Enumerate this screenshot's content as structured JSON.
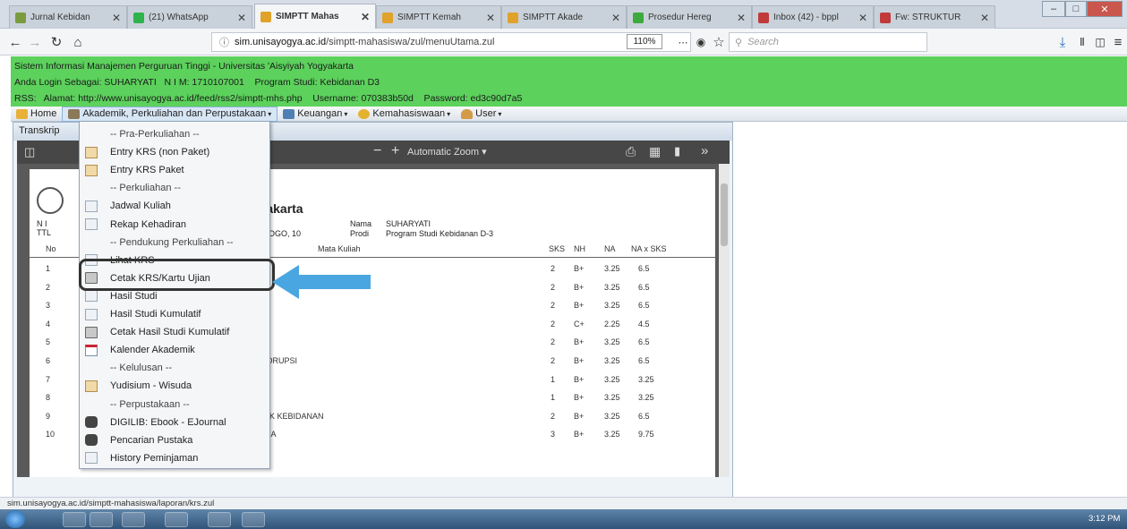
{
  "browser": {
    "tabs": [
      {
        "title": "Jurnal Kebidan",
        "color": "#7a9c3d"
      },
      {
        "title": "(21) WhatsApp",
        "color": "#2fb34b"
      },
      {
        "title": "SIMPTT Mahas",
        "color": "#e0a22a",
        "active": true
      },
      {
        "title": "SIMPTT Kemah",
        "color": "#e0a22a"
      },
      {
        "title": "SIMPTT Akade",
        "color": "#e0a22a"
      },
      {
        "title": "Prosedur Hereg",
        "color": "#3caa3c"
      },
      {
        "title": "Inbox (42) - bppl",
        "color": "#c03a3a"
      },
      {
        "title": "Fw: STRUKTUR",
        "color": "#c03a3a"
      }
    ],
    "url_host": "sim.unisayogya.ac.id",
    "url_path": "/simptt-mahasiswa/zul/menuUtama.zul",
    "zoom": "110%",
    "search_placeholder": "Search",
    "status_url": "sim.unisayogya.ac.id/simptt-mahasiswa/laporan/krs.zul"
  },
  "info": {
    "line1": "Sistem Informasi Manajemen Perguruan Tinggi - Universitas 'Aisyiyah Yogyakarta",
    "line2": "Anda Login Sebagai: SUHARYATI   N I M: 1710107001    Program Studi: Kebidanan D3",
    "line3": "RSS:   Alamat: http://www.unisayogya.ac.id/feed/rss2/simptt-mhs.php    Username: 070383b50d    Password: ed3c90d7a5"
  },
  "menu": {
    "home": "Home",
    "akademik": "Akademik, Perkuliahan dan Perpustakaan",
    "keuangan": "Keuangan",
    "kemahasiswaan": "Kemahasiswaan",
    "user": "User"
  },
  "panel": {
    "tab_title": "Transkrip",
    "zoom_label": "Automatic Zoom"
  },
  "dropdown": [
    {
      "label": "-- Pra-Perkuliahan --",
      "sep": true
    },
    {
      "label": "Entry KRS (non Paket)",
      "icon": "form"
    },
    {
      "label": "Entry KRS Paket",
      "icon": "form"
    },
    {
      "label": "-- Perkuliahan --",
      "sep": true
    },
    {
      "label": "Jadwal Kuliah",
      "icon": "doc"
    },
    {
      "label": "Rekap Kehadiran",
      "icon": "doc"
    },
    {
      "label": "-- Pendukung Perkuliahan --",
      "sep": true
    },
    {
      "label": "Lihat KRS",
      "icon": "doc"
    },
    {
      "label": "Cetak KRS/Kartu Ujian",
      "icon": "printer"
    },
    {
      "label": "Hasil Studi",
      "icon": "doc"
    },
    {
      "label": "Hasil Studi Kumulatif",
      "icon": "doc"
    },
    {
      "label": "Cetak Hasil Studi Kumulatif",
      "icon": "printer"
    },
    {
      "label": "Kalender Akademik",
      "icon": "calendar"
    },
    {
      "label": "-- Kelulusan --",
      "sep": true
    },
    {
      "label": "Yudisium - Wisuda",
      "icon": "form"
    },
    {
      "label": "-- Perpustakaan --",
      "sep": true
    },
    {
      "label": "DIGILIB: Ebook - EJournal",
      "icon": "binoculars"
    },
    {
      "label": "Pencarian Pustaka",
      "icon": "binoculars"
    },
    {
      "label": "History Peminjaman",
      "icon": "doc"
    }
  ],
  "transcript": {
    "title_fragment": "gyakarta",
    "nim_label": "N I",
    "ttl_label": "TTL",
    "birthplace_fragment": "NPROGO, 10",
    "nama_label": "Nama",
    "nama_value": "SUHARYATI",
    "prodi_label": "Prodi",
    "prodi_value": "Program Studi Kebidanan D-3",
    "headers": {
      "no": "No",
      "matkul": "Mata Kuliah",
      "sks": "SKS",
      "nh": "NH",
      "na": "NA",
      "naxsks": "NA x SKS"
    },
    "rows": [
      {
        "no": "1",
        "matkul": "",
        "sks": "2",
        "nh": "B+",
        "na": "3.25",
        "naxsks": "6.5"
      },
      {
        "no": "2",
        "matkul": "",
        "sks": "2",
        "nh": "B+",
        "na": "3.25",
        "naxsks": "6.5"
      },
      {
        "no": "3",
        "matkul": "",
        "sks": "2",
        "nh": "B+",
        "na": "3.25",
        "naxsks": "6.5"
      },
      {
        "no": "4",
        "matkul": "",
        "sks": "2",
        "nh": "C+",
        "na": "2.25",
        "naxsks": "4.5"
      },
      {
        "no": "5",
        "matkul": "",
        "sks": "2",
        "nh": "B+",
        "na": "3.25",
        "naxsks": "6.5"
      },
      {
        "no": "6",
        "matkul": "TI KORUPSI",
        "sks": "2",
        "nh": "B+",
        "na": "3.25",
        "naxsks": "6.5"
      },
      {
        "no": "7",
        "matkul": "",
        "sks": "1",
        "nh": "B+",
        "na": "3.25",
        "naxsks": "3.25"
      },
      {
        "no": "8",
        "matkul": "",
        "sks": "1",
        "nh": "B+",
        "na": "3.25",
        "naxsks": "3.25"
      },
      {
        "no": "9",
        "matkul": "AKTIK KEBIDANAN",
        "sks": "2",
        "nh": "B+",
        "na": "3.25",
        "naxsks": "6.5"
      },
      {
        "no": "10",
        "matkul": "NUSIA",
        "sks": "3",
        "nh": "B+",
        "na": "3.25",
        "naxsks": "9.75"
      }
    ]
  },
  "taskbar": {
    "clock": "3:12 PM"
  }
}
